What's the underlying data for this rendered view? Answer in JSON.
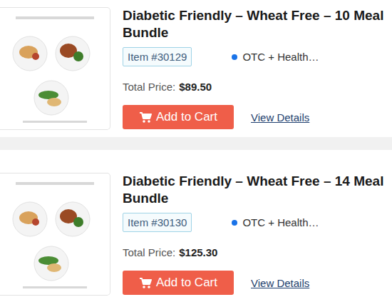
{
  "products": [
    {
      "title": "Diabetic Friendly – Wheat Free – 10 Meal Bundle",
      "item": "Item #30129",
      "category": "OTC + Health…",
      "price_label": "Total Price:",
      "price": "$89.50",
      "button": "Add to Cart",
      "link": "View Details"
    },
    {
      "title": "Diabetic Friendly – Wheat Free – 14 Meal Bundle",
      "item": "Item #30130",
      "category": "OTC + Health…",
      "price_label": "Total Price:",
      "price": "$125.30",
      "button": "Add to Cart",
      "link": "View Details"
    }
  ]
}
